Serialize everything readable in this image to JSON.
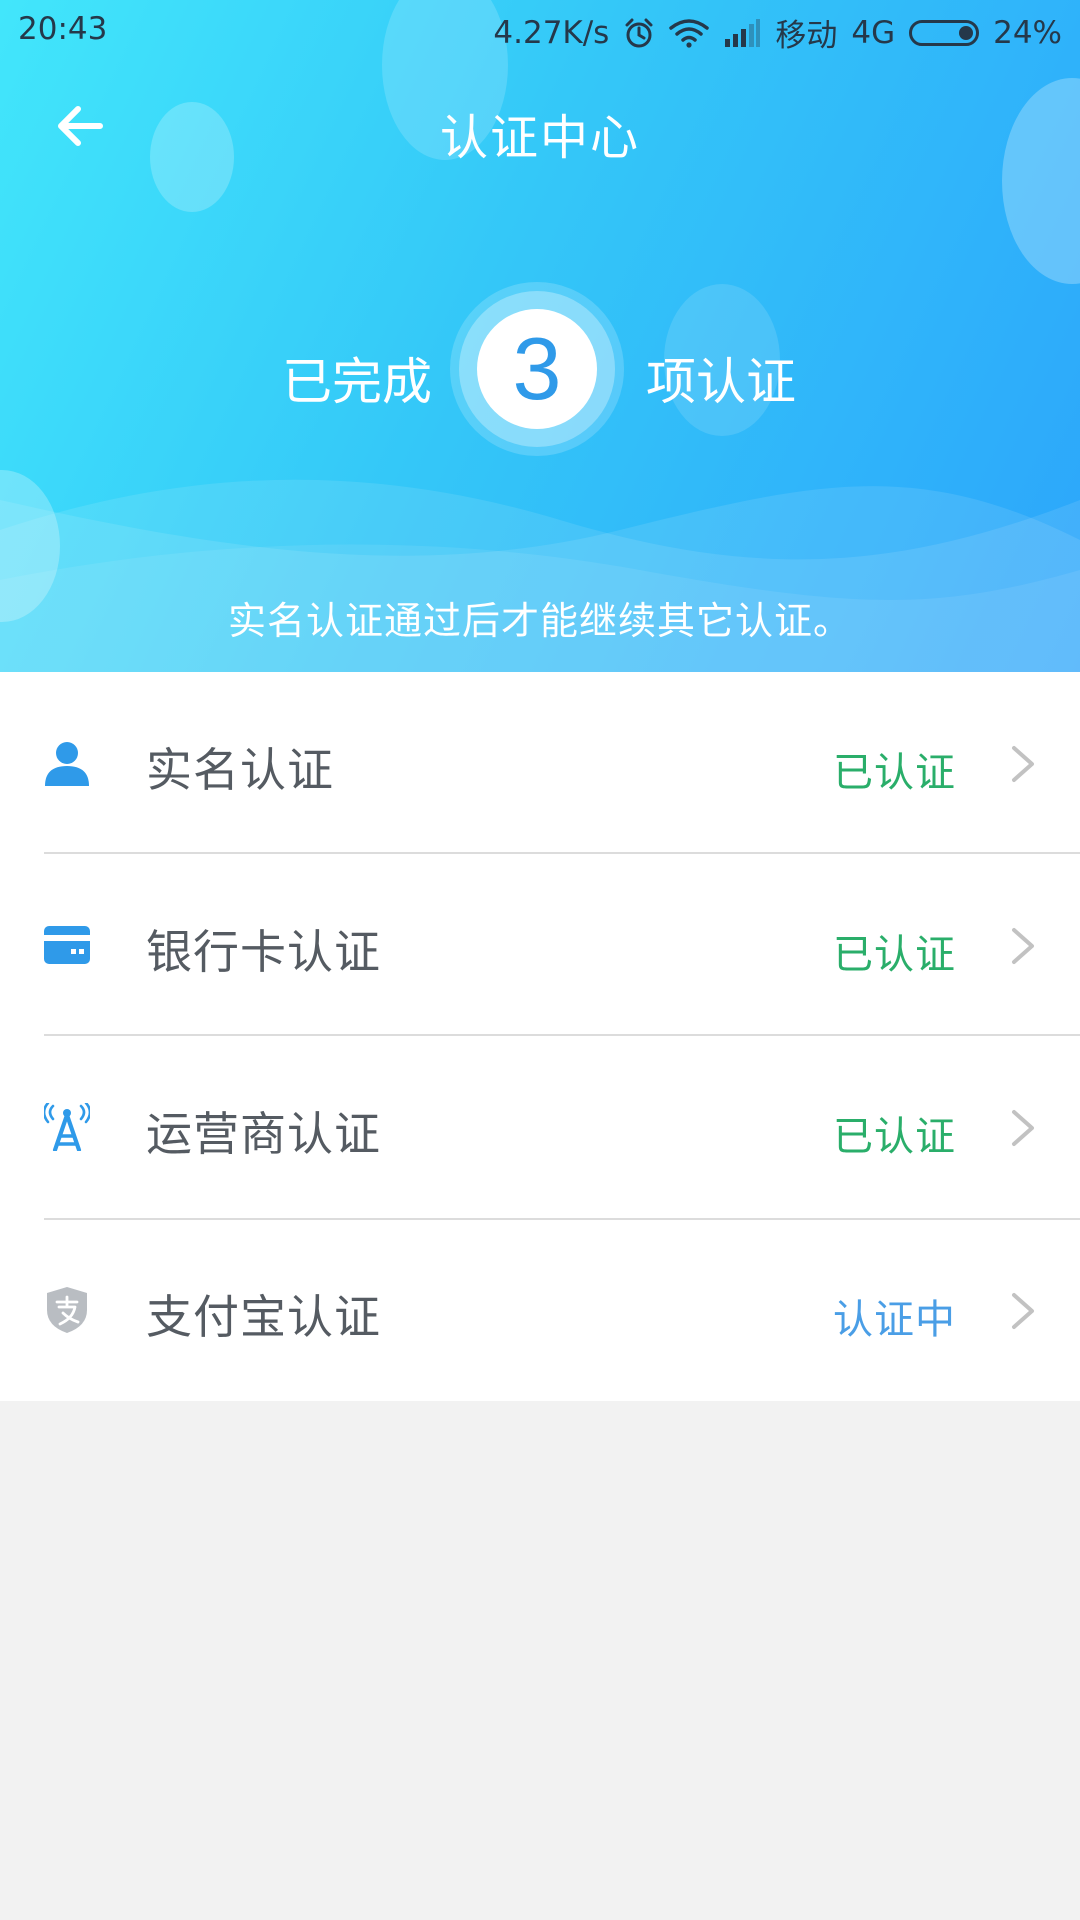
{
  "status_bar": {
    "time": "20:43",
    "network_speed": "4.27K/s",
    "carrier": "移动",
    "network_type": "4G",
    "battery": "24%",
    "battery_level": 0.24,
    "icons": [
      "alarm-icon",
      "wifi-icon",
      "signal-icon",
      "battery-icon"
    ]
  },
  "header": {
    "title": "认证中心",
    "back_icon": "arrow-left-icon",
    "summary_prefix": "已完成",
    "completed_count": "3",
    "summary_suffix": "项认证",
    "hint": "实名认证通过后才能继续其它认证。"
  },
  "colors": {
    "header_gradient_start": "#42e6fb",
    "header_gradient_end": "#2ca5fb",
    "icon_blue": "#2f9ae9",
    "status_verified": "#2aae6a",
    "status_pending": "#4a9ee6",
    "page_background": "#f2f2f2"
  },
  "auth_items": [
    {
      "label": "实名认证",
      "status": "已认证",
      "status_color": "#2aae6a",
      "icon": "person-icon"
    },
    {
      "label": "银行卡认证",
      "status": "已认证",
      "status_color": "#2aae6a",
      "icon": "bank-card-icon"
    },
    {
      "label": "运营商认证",
      "status": "已认证",
      "status_color": "#2aae6a",
      "icon": "signal-tower-icon"
    },
    {
      "label": "支付宝认证",
      "status": "认证中",
      "status_color": "#4a9ee6",
      "icon": "alipay-shield-icon"
    }
  ]
}
